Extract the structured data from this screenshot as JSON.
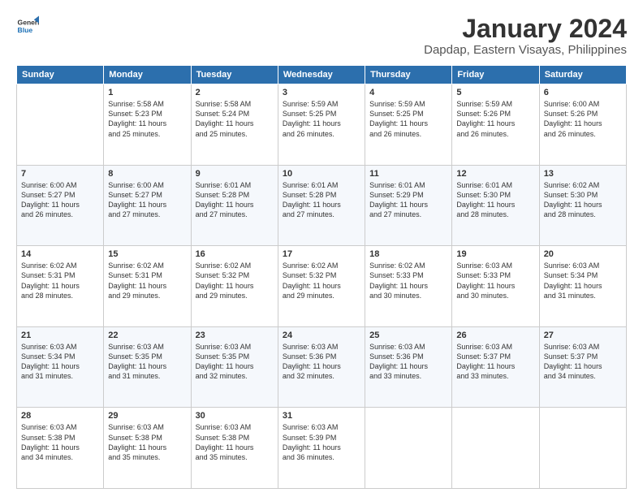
{
  "logo": {
    "line1": "General",
    "line2": "Blue"
  },
  "title": "January 2024",
  "subtitle": "Dapdap, Eastern Visayas, Philippines",
  "days_of_week": [
    "Sunday",
    "Monday",
    "Tuesday",
    "Wednesday",
    "Thursday",
    "Friday",
    "Saturday"
  ],
  "weeks": [
    [
      {
        "day": "",
        "info": ""
      },
      {
        "day": "1",
        "info": "Sunrise: 5:58 AM\nSunset: 5:23 PM\nDaylight: 11 hours\nand 25 minutes."
      },
      {
        "day": "2",
        "info": "Sunrise: 5:58 AM\nSunset: 5:24 PM\nDaylight: 11 hours\nand 25 minutes."
      },
      {
        "day": "3",
        "info": "Sunrise: 5:59 AM\nSunset: 5:25 PM\nDaylight: 11 hours\nand 26 minutes."
      },
      {
        "day": "4",
        "info": "Sunrise: 5:59 AM\nSunset: 5:25 PM\nDaylight: 11 hours\nand 26 minutes."
      },
      {
        "day": "5",
        "info": "Sunrise: 5:59 AM\nSunset: 5:26 PM\nDaylight: 11 hours\nand 26 minutes."
      },
      {
        "day": "6",
        "info": "Sunrise: 6:00 AM\nSunset: 5:26 PM\nDaylight: 11 hours\nand 26 minutes."
      }
    ],
    [
      {
        "day": "7",
        "info": "Sunrise: 6:00 AM\nSunset: 5:27 PM\nDaylight: 11 hours\nand 26 minutes."
      },
      {
        "day": "8",
        "info": "Sunrise: 6:00 AM\nSunset: 5:27 PM\nDaylight: 11 hours\nand 27 minutes."
      },
      {
        "day": "9",
        "info": "Sunrise: 6:01 AM\nSunset: 5:28 PM\nDaylight: 11 hours\nand 27 minutes."
      },
      {
        "day": "10",
        "info": "Sunrise: 6:01 AM\nSunset: 5:28 PM\nDaylight: 11 hours\nand 27 minutes."
      },
      {
        "day": "11",
        "info": "Sunrise: 6:01 AM\nSunset: 5:29 PM\nDaylight: 11 hours\nand 27 minutes."
      },
      {
        "day": "12",
        "info": "Sunrise: 6:01 AM\nSunset: 5:30 PM\nDaylight: 11 hours\nand 28 minutes."
      },
      {
        "day": "13",
        "info": "Sunrise: 6:02 AM\nSunset: 5:30 PM\nDaylight: 11 hours\nand 28 minutes."
      }
    ],
    [
      {
        "day": "14",
        "info": "Sunrise: 6:02 AM\nSunset: 5:31 PM\nDaylight: 11 hours\nand 28 minutes."
      },
      {
        "day": "15",
        "info": "Sunrise: 6:02 AM\nSunset: 5:31 PM\nDaylight: 11 hours\nand 29 minutes."
      },
      {
        "day": "16",
        "info": "Sunrise: 6:02 AM\nSunset: 5:32 PM\nDaylight: 11 hours\nand 29 minutes."
      },
      {
        "day": "17",
        "info": "Sunrise: 6:02 AM\nSunset: 5:32 PM\nDaylight: 11 hours\nand 29 minutes."
      },
      {
        "day": "18",
        "info": "Sunrise: 6:02 AM\nSunset: 5:33 PM\nDaylight: 11 hours\nand 30 minutes."
      },
      {
        "day": "19",
        "info": "Sunrise: 6:03 AM\nSunset: 5:33 PM\nDaylight: 11 hours\nand 30 minutes."
      },
      {
        "day": "20",
        "info": "Sunrise: 6:03 AM\nSunset: 5:34 PM\nDaylight: 11 hours\nand 31 minutes."
      }
    ],
    [
      {
        "day": "21",
        "info": "Sunrise: 6:03 AM\nSunset: 5:34 PM\nDaylight: 11 hours\nand 31 minutes."
      },
      {
        "day": "22",
        "info": "Sunrise: 6:03 AM\nSunset: 5:35 PM\nDaylight: 11 hours\nand 31 minutes."
      },
      {
        "day": "23",
        "info": "Sunrise: 6:03 AM\nSunset: 5:35 PM\nDaylight: 11 hours\nand 32 minutes."
      },
      {
        "day": "24",
        "info": "Sunrise: 6:03 AM\nSunset: 5:36 PM\nDaylight: 11 hours\nand 32 minutes."
      },
      {
        "day": "25",
        "info": "Sunrise: 6:03 AM\nSunset: 5:36 PM\nDaylight: 11 hours\nand 33 minutes."
      },
      {
        "day": "26",
        "info": "Sunrise: 6:03 AM\nSunset: 5:37 PM\nDaylight: 11 hours\nand 33 minutes."
      },
      {
        "day": "27",
        "info": "Sunrise: 6:03 AM\nSunset: 5:37 PM\nDaylight: 11 hours\nand 34 minutes."
      }
    ],
    [
      {
        "day": "28",
        "info": "Sunrise: 6:03 AM\nSunset: 5:38 PM\nDaylight: 11 hours\nand 34 minutes."
      },
      {
        "day": "29",
        "info": "Sunrise: 6:03 AM\nSunset: 5:38 PM\nDaylight: 11 hours\nand 35 minutes."
      },
      {
        "day": "30",
        "info": "Sunrise: 6:03 AM\nSunset: 5:38 PM\nDaylight: 11 hours\nand 35 minutes."
      },
      {
        "day": "31",
        "info": "Sunrise: 6:03 AM\nSunset: 5:39 PM\nDaylight: 11 hours\nand 36 minutes."
      },
      {
        "day": "",
        "info": ""
      },
      {
        "day": "",
        "info": ""
      },
      {
        "day": "",
        "info": ""
      }
    ]
  ]
}
